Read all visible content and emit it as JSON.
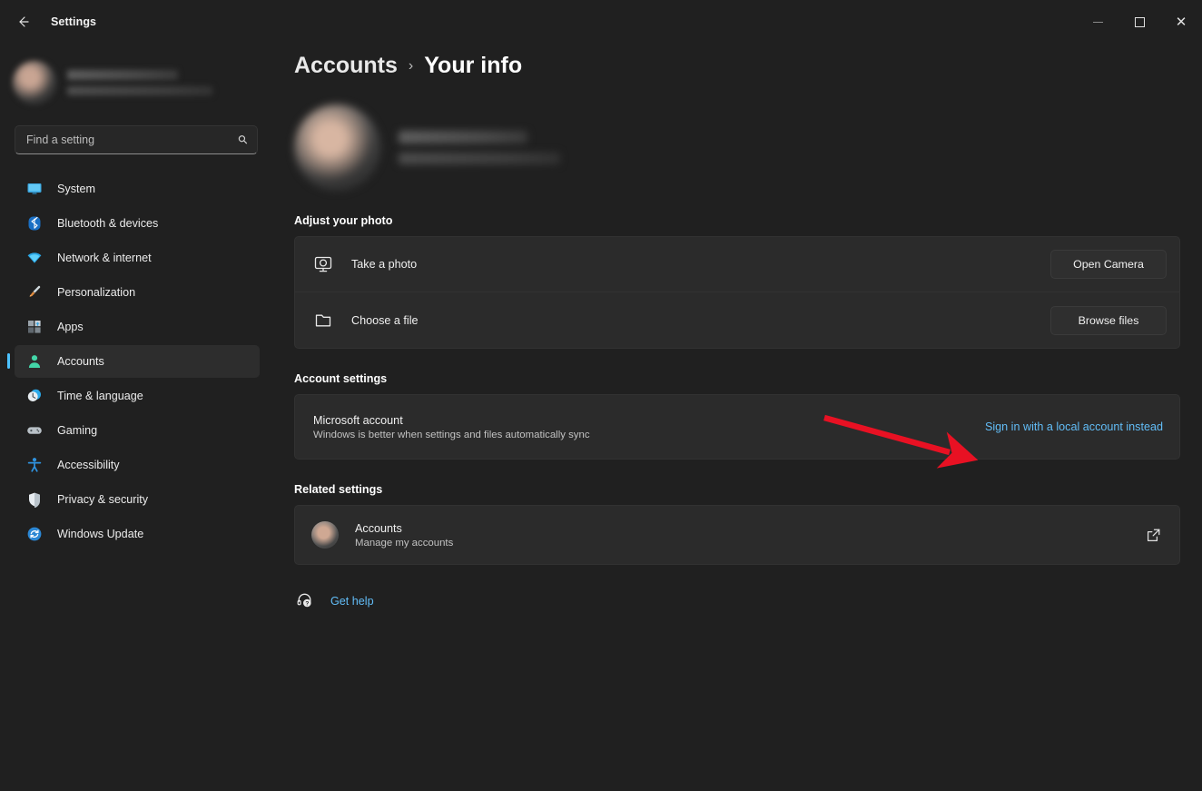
{
  "window": {
    "title": "Settings",
    "back_icon": "back-arrow-icon",
    "minimize_label": "Minimize",
    "maximize_label": "Maximize",
    "close_label": "Close"
  },
  "sidebar": {
    "profile": {
      "name_redacted": "",
      "email_redacted": ""
    },
    "search": {
      "placeholder": "Find a setting",
      "value": "",
      "icon": "search-icon"
    },
    "items": [
      {
        "label": "System",
        "icon": "monitor-icon",
        "active": false
      },
      {
        "label": "Bluetooth & devices",
        "icon": "bluetooth-icon",
        "active": false
      },
      {
        "label": "Network & internet",
        "icon": "wifi-icon",
        "active": false
      },
      {
        "label": "Personalization",
        "icon": "paintbrush-icon",
        "active": false
      },
      {
        "label": "Apps",
        "icon": "apps-grid-icon",
        "active": false
      },
      {
        "label": "Accounts",
        "icon": "person-icon",
        "active": true
      },
      {
        "label": "Time & language",
        "icon": "clock-globe-icon",
        "active": false
      },
      {
        "label": "Gaming",
        "icon": "gamepad-icon",
        "active": false
      },
      {
        "label": "Accessibility",
        "icon": "accessibility-person-icon",
        "active": false
      },
      {
        "label": "Privacy & security",
        "icon": "shield-icon",
        "active": false
      },
      {
        "label": "Windows Update",
        "icon": "refresh-circle-icon",
        "active": false
      }
    ]
  },
  "breadcrumb": {
    "parent": "Accounts",
    "separator": "›",
    "current": "Your info"
  },
  "sections": {
    "adjust_photo": {
      "title": "Adjust your photo",
      "rows": [
        {
          "label": "Take a photo",
          "icon": "camera-icon",
          "button": "Open Camera"
        },
        {
          "label": "Choose a file",
          "icon": "folder-icon",
          "button": "Browse files"
        }
      ]
    },
    "account_settings": {
      "title": "Account settings",
      "row": {
        "label": "Microsoft account",
        "sublabel": "Windows is better when settings and files automatically sync",
        "link": "Sign in with a local account instead"
      }
    },
    "related_settings": {
      "title": "Related settings",
      "row": {
        "label": "Accounts",
        "sublabel": "Manage my accounts",
        "icon": "account-avatar-icon",
        "action_icon": "external-link-icon"
      }
    },
    "get_help": {
      "label": "Get help",
      "icon": "help-question-icon"
    }
  },
  "annotation": {
    "type": "arrow",
    "color": "#e81123",
    "points_to": "Sign in with a local account instead"
  },
  "colors": {
    "background": "#202020",
    "card": "#2b2b2b",
    "accent": "#4cc2ff",
    "link": "#62bdf7",
    "text": "#f0f0f0",
    "annotation_red": "#e81123"
  }
}
